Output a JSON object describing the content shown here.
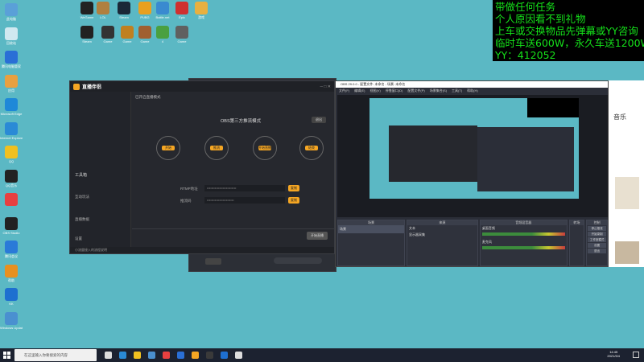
{
  "overlay": {
    "lines": [
      "带做任何任务",
      "个人原因看不到礼物",
      "上车或交换物品先弹幕或YY咨询",
      "临时车送600W，永久车送1200W",
      "YY：412052"
    ]
  },
  "desktop": {
    "icons_col1": [
      {
        "label": "此电脑",
        "icon": "computer-icon",
        "color": "#5aa0d8"
      },
      {
        "label": "回收站",
        "icon": "recycle-bin-icon",
        "color": "#d0e8f0"
      },
      {
        "label": "腾讯电脑管家",
        "icon": "shield-icon",
        "color": "#2a6fd6"
      },
      {
        "label": "应用",
        "icon": "app-icon",
        "color": "#e8a040"
      },
      {
        "label": "Microsoft Edge",
        "icon": "edge-icon",
        "color": "#1e88d8"
      },
      {
        "label": "Internet Explorer",
        "icon": "ie-icon",
        "color": "#2a8ad6"
      },
      {
        "label": "QQ",
        "icon": "qq-icon",
        "color": "#f0c020"
      },
      {
        "label": "QQ音乐",
        "icon": "qq-icon",
        "color": "#222"
      },
      {
        "label": "",
        "icon": "app-icon",
        "color": "#e84040"
      },
      {
        "label": "OBS Studio",
        "icon": "obs-icon",
        "color": "#222"
      },
      {
        "label": "腾讯会议",
        "icon": "app-icon",
        "color": "#2a7ad8"
      },
      {
        "label": "帮助",
        "icon": "help-icon",
        "color": "#e89020"
      },
      {
        "label": "KK",
        "icon": "app-icon",
        "color": "#1e6fd0"
      },
      {
        "label": "Windows Update",
        "icon": "app-icon",
        "color": "#4a90d0"
      }
    ],
    "icons_grid": [
      {
        "label": "WeGame",
        "icon": "wegame-icon",
        "color": "#222"
      },
      {
        "label": "LOL",
        "icon": "game-icon",
        "color": "#b08040"
      },
      {
        "label": "Steam",
        "icon": "steam-icon",
        "color": "#1b2838"
      },
      {
        "label": "PUBG",
        "icon": "game-icon",
        "color": "#e8a020"
      },
      {
        "label": "Battle.net",
        "icon": "game-icon",
        "color": "#3a8ad0"
      },
      {
        "label": "Epic",
        "icon": "game-icon",
        "color": "#d03030"
      },
      {
        "label": "游戏",
        "icon": "game-icon",
        "color": "#e8b040"
      },
      {
        "label": "Steam",
        "icon": "game-icon",
        "color": "#222"
      },
      {
        "label": "Game",
        "icon": "game-icon",
        "color": "#333"
      },
      {
        "label": "Game",
        "icon": "game-icon",
        "color": "#c08020"
      },
      {
        "label": "Game",
        "icon": "game-icon",
        "color": "#a06030"
      },
      {
        "label": "4",
        "icon": "game-icon",
        "color": "#4aa040"
      },
      {
        "label": "Game",
        "icon": "game-icon",
        "color": "#606060"
      }
    ]
  },
  "streamer": {
    "title": "直播伴侣",
    "header_text": "已开启直播模式",
    "center_label": "OBS第三方推流模式",
    "exit_btn": "退出",
    "steps": [
      "第1步",
      "第2步",
      "第3步",
      "第4步"
    ],
    "step_btns": [
      "开始",
      "推流",
      "开始直播",
      "结束"
    ],
    "rtmp_label": "RTMP地址",
    "rtmp_value": "••••••••••••••••••••••••••",
    "key_label": "推流码",
    "key_value": "••••••••••••••••••••••••",
    "copy_btn": "复制",
    "side_items": [
      "工具箱",
      "互动玩法",
      "直播数据",
      "设置"
    ],
    "bottom_btn": "开始直播",
    "status": "小流量接入的流程说明"
  },
  "obs": {
    "title": "OBS 29.0.0 - 配置文件: 未命名 - 场景: 未命名",
    "menu": [
      "文件(F)",
      "编辑(E)",
      "视图(V)",
      "停靠窗口(D)",
      "配置文件(P)",
      "场景集合(S)",
      "工具(T)",
      "帮助(H)"
    ],
    "docks": [
      "场景",
      "来源",
      "音频混音器",
      "转场",
      "控制"
    ],
    "scene_item": "场景",
    "source_items": [
      "文本",
      "显示器采集"
    ],
    "mixer_labels": [
      "桌面音频",
      "麦克风"
    ],
    "transition": "淡入淡出",
    "duration": "300 ms",
    "controls": [
      "停止推流",
      "开始录制",
      "工作室模式",
      "设置",
      "退出"
    ]
  },
  "browser_strip": {
    "label": "音乐"
  },
  "taskbar": {
    "search_placeholder": "在这里输入你要搜索的内容",
    "time": "14:45",
    "date": "2021/3/4"
  },
  "colors": {
    "desktop_bg": "#5bb8c4",
    "overlay_text": "#15e21a",
    "accent": "#f5a623"
  }
}
